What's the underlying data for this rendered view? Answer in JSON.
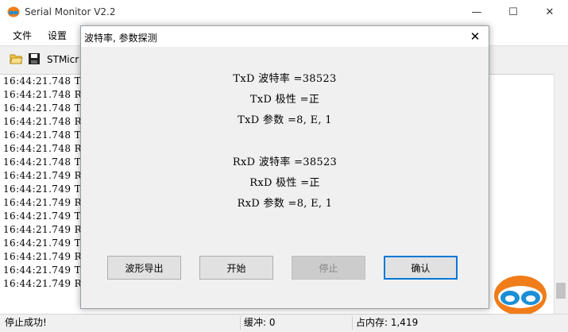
{
  "window": {
    "title": "Serial Monitor V2.2",
    "minimize_glyph": "—",
    "maximize_glyph": "☐",
    "close_glyph": "✕"
  },
  "menu": [
    "文件",
    "设置"
  ],
  "toolbar": {
    "device": "STMicr"
  },
  "log_lines": [
    "16:44:21.748 T",
    "16:44:21.748 R",
    "16:44:21.748 T",
    "16:44:21.748 R",
    "16:44:21.748 T",
    "16:44:21.748 R",
    "16:44:21.748 T",
    "16:44:21.749 R",
    "16:44:21.749 T",
    "16:44:21.749 R",
    "16:44:21.749 T",
    "16:44:21.749 R",
    "16:44:21.749 T",
    "16:44:21.749 R",
    "16:44:21.749 T",
    "16:44:21.749 R"
  ],
  "status": {
    "message": "停止成功!",
    "buffer": "缓冲: 0",
    "memory": "占内存: 1,419"
  },
  "dialog": {
    "title": "波特率, 参数探测",
    "close_glyph": "✕",
    "txd_baud": "TxD 波特率 =38523",
    "txd_polarity": "TxD 极性 =正",
    "txd_params": "TxD 参数 =8, E, 1",
    "rxd_baud": "RxD 波特率 =38523",
    "rxd_polarity": "RxD 极性 =正",
    "rxd_params": "RxD 参数 =8, E, 1",
    "buttons": {
      "export": "波形导出",
      "start": "开始",
      "stop": "停止",
      "ok": "确认"
    }
  },
  "colors": {
    "accent": "#0078d7",
    "logo_orange": "#f07d1a",
    "logo_blue": "#1a8fd6"
  }
}
